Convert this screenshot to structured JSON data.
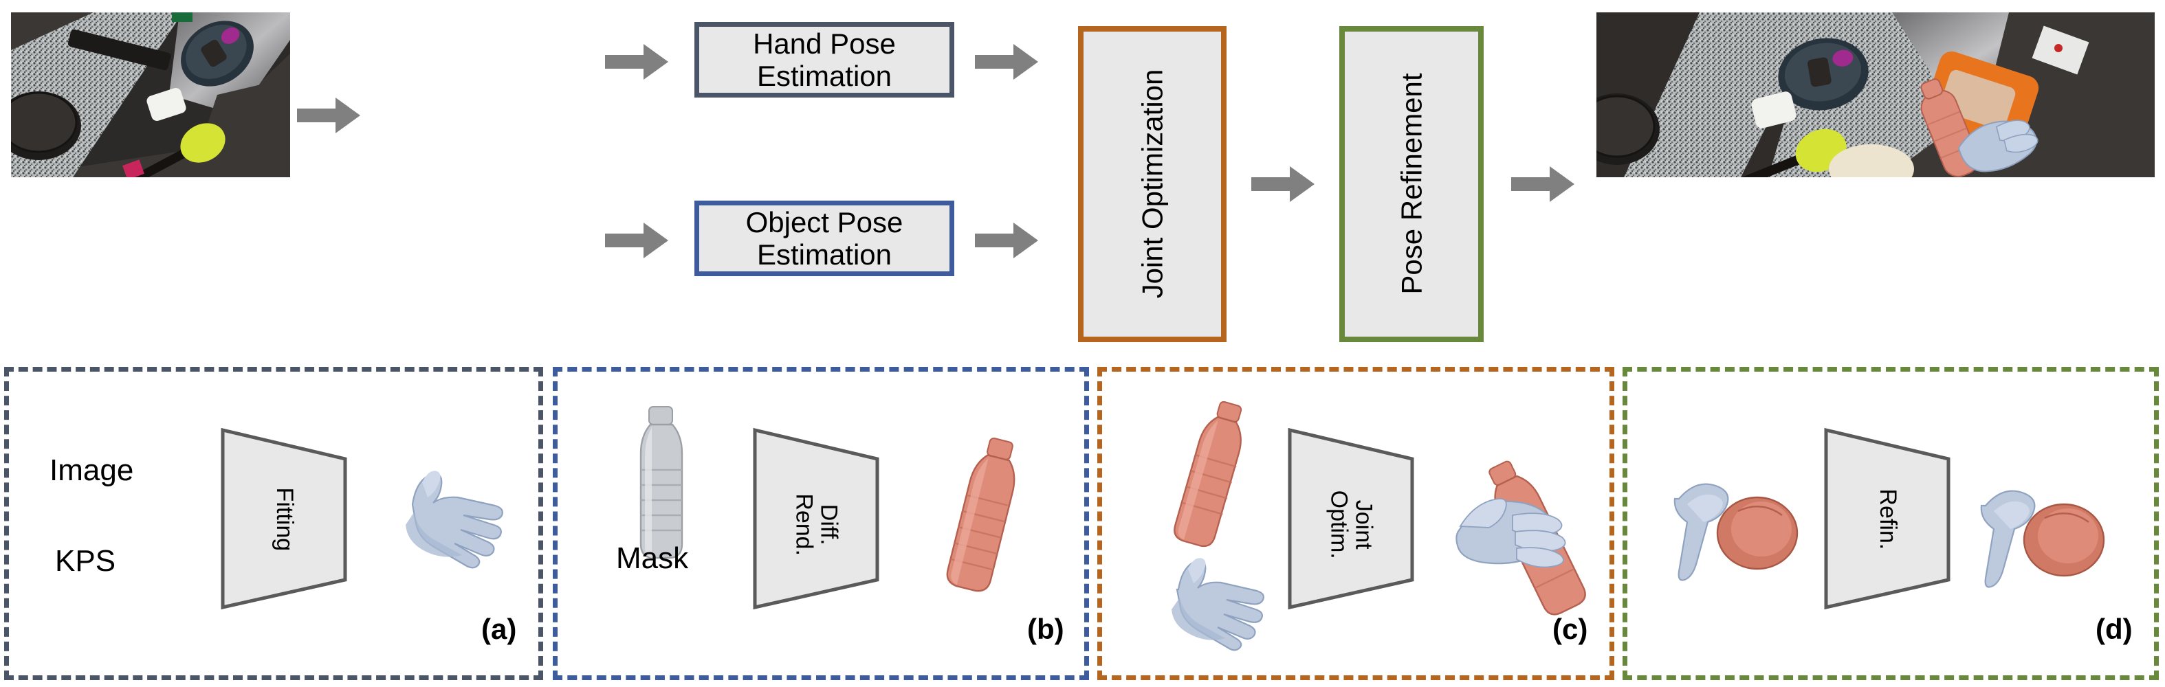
{
  "figure": {
    "kind": "method-pipeline-diagram",
    "top_row": {
      "input_image": {
        "name": "input-frame",
        "caption": ""
      },
      "boxes": [
        {
          "id": "hand-pose-estimation",
          "label": "Hand Pose\nEstimation",
          "label_line1": "Hand Pose",
          "label_line2": "Estimation",
          "border_color": "#4a5568",
          "fill": "#e8e8e8",
          "orientation": "horizontal"
        },
        {
          "id": "object-pose-estimation",
          "label": "Object Pose\nEstimation",
          "label_line1": "Object Pose",
          "label_line2": "Estimation",
          "border_color": "#3e5b9e",
          "fill": "#e8e8e8",
          "orientation": "horizontal"
        },
        {
          "id": "joint-optimization",
          "label": "Joint Optimization",
          "border_color": "#b5651d",
          "fill": "#e8e8e8",
          "orientation": "vertical"
        },
        {
          "id": "pose-refinement",
          "label": "Pose Refinement",
          "border_color": "#68883c",
          "fill": "#e8e8e8",
          "orientation": "vertical"
        }
      ],
      "arrows": {
        "color": "#808080",
        "count": 6
      },
      "output_image": {
        "name": "output-frame-with-overlay",
        "caption": ""
      }
    },
    "bottom_row": {
      "panels": [
        {
          "id": "panel-a",
          "tag": "(a)",
          "border_color": "#4a5568",
          "inputs": [
            "Image",
            "KPS"
          ],
          "module_label": "Fitting",
          "module_label_lines": [
            "Fitting"
          ],
          "outputs": [
            "hand-mesh"
          ]
        },
        {
          "id": "panel-b",
          "tag": "(b)",
          "border_color": "#3e5b9e",
          "inputs": [
            "Mask"
          ],
          "module_label": "Diff. Rend.",
          "module_label_lines": [
            "Diff.",
            "Rend."
          ],
          "outputs": [
            "bottle-mesh"
          ]
        },
        {
          "id": "panel-c",
          "tag": "(c)",
          "border_color": "#b5651d",
          "inputs": [],
          "module_label": "Joint Optim.",
          "module_label_lines": [
            "Joint",
            "Optim."
          ],
          "outputs": [
            "hand-grasping-bottle"
          ]
        },
        {
          "id": "panel-d",
          "tag": "(d)",
          "border_color": "#68883c",
          "inputs": [],
          "module_label": "Refin.",
          "module_label_lines": [
            "Refin."
          ],
          "outputs": [
            "refined-hand-object"
          ]
        }
      ]
    },
    "colors": {
      "hand_mesh": "#b9c7dd",
      "object_mesh": "#de8b79",
      "mask_mesh": "#c3c6cb",
      "module_fill": "#e8e8e8",
      "module_stroke": "#5a5a5a",
      "arrow_gray": "#808080",
      "slate": "#4a5568",
      "blue": "#3e5b9e",
      "orange": "#b5651d",
      "green": "#68883c"
    }
  }
}
